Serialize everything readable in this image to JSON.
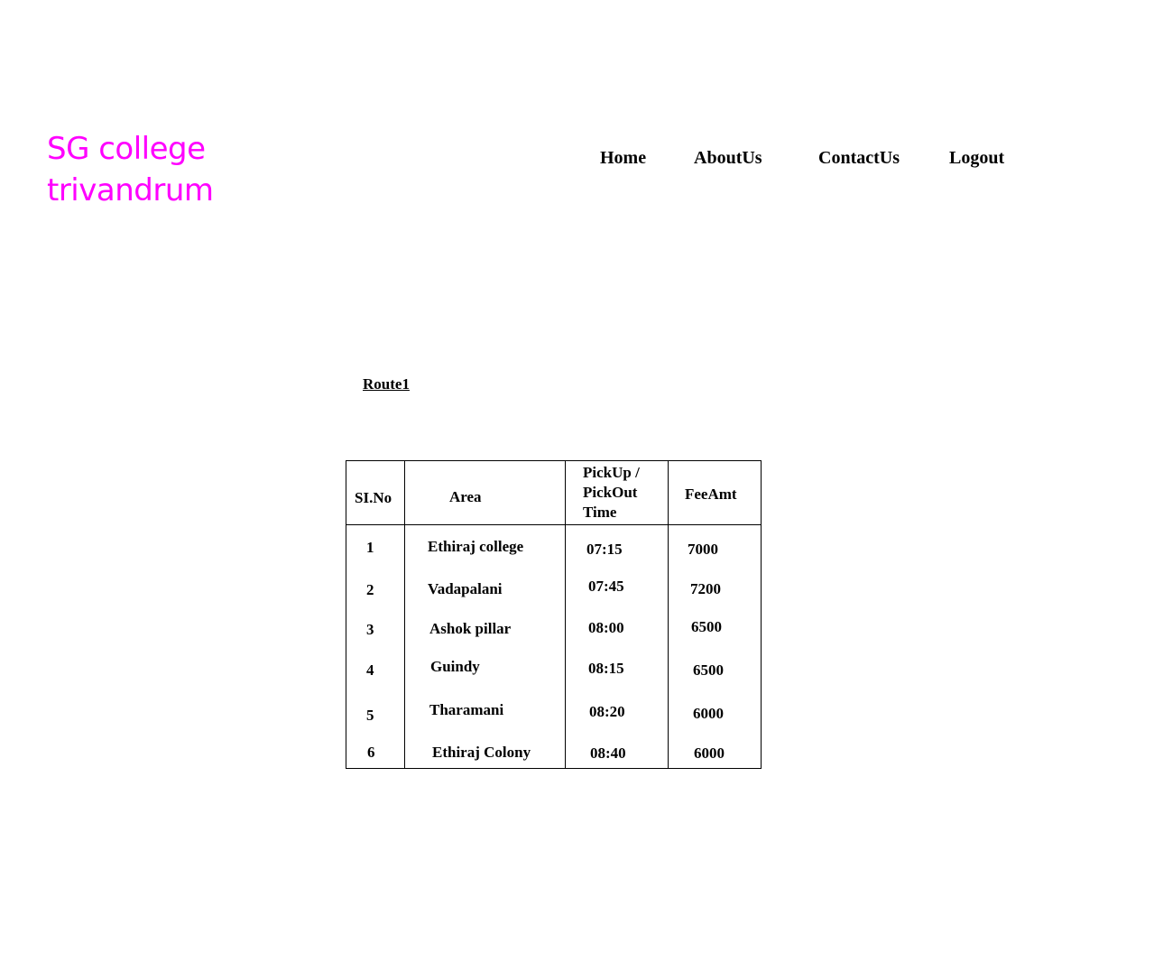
{
  "brand": {
    "line1": "SG college",
    "line2": "trivandrum",
    "color": "#ff00ff"
  },
  "nav": {
    "home": "Home",
    "about": "AboutUs",
    "contact": "ContactUs",
    "logout": "Logout"
  },
  "route": {
    "title": "Route1"
  },
  "table": {
    "headers": {
      "slno": "SI.No",
      "area": "Area",
      "time_line1": "PickUp /",
      "time_line2": "PickOut",
      "time_line3": "Time",
      "fee": "FeeAmt"
    },
    "rows": [
      {
        "slno": "1",
        "area": "Ethiraj college",
        "time": "07:15",
        "fee": "7000"
      },
      {
        "slno": "2",
        "area": "Vadapalani",
        "time": "07:45",
        "fee": "7200"
      },
      {
        "slno": "3",
        "area": "Ashok pillar",
        "time": "08:00",
        "fee": "6500"
      },
      {
        "slno": "4",
        "area": "Guindy",
        "time": "08:15",
        "fee": "6500"
      },
      {
        "slno": "5",
        "area": "Tharamani",
        "time": "08:20",
        "fee": "6000"
      },
      {
        "slno": "6",
        "area": "Ethiraj Colony",
        "time": "08:40",
        "fee": "6000"
      }
    ]
  }
}
